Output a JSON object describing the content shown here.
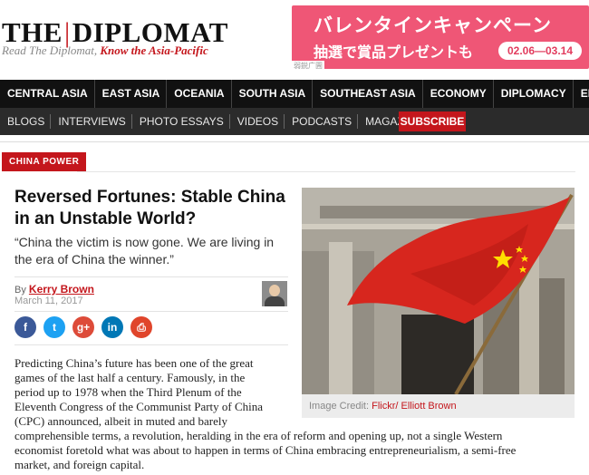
{
  "header": {
    "logo_left": "THE",
    "logo_sep": "|",
    "logo_right": "DIPLOMAT",
    "tagline_plain": "Read The Diplomat,",
    "tagline_em": "Know the Asia-Pacific"
  },
  "ad": {
    "line1": "バレンタインキャンペーン",
    "line2": "抽選で賞品プレゼントも",
    "dates": "02.06—03.14",
    "label": "弱鋭广圊"
  },
  "nav_main": [
    "CENTRAL ASIA",
    "EAST ASIA",
    "OCEANIA",
    "SOUTH ASIA",
    "SOUTHEAST ASIA",
    "ECONOMY",
    "DIPLOMACY",
    "ENVIRON"
  ],
  "nav_secondary": [
    "BLOGS",
    "INTERVIEWS",
    "PHOTO ESSAYS",
    "VIDEOS",
    "PODCASTS",
    "MAGAZINE"
  ],
  "subscribe_label": "SUBSCRIBE",
  "article": {
    "section": "CHINA POWER",
    "title": "Reversed Fortunes: Stable China in an Unstable World?",
    "dek": "“China the victim is now gone. We are living in the era of China the winner.”",
    "by_prefix": "By",
    "author": "Kerry Brown",
    "date": "March 11, 2017",
    "share_icons": [
      {
        "name": "facebook-icon",
        "glyph": "f",
        "color": "#3b5998"
      },
      {
        "name": "twitter-icon",
        "glyph": "t",
        "color": "#1da1f2"
      },
      {
        "name": "google-plus-icon",
        "glyph": "g+",
        "color": "#dd4b39"
      },
      {
        "name": "linkedin-icon",
        "glyph": "in",
        "color": "#0077b5"
      },
      {
        "name": "print-icon",
        "glyph": "⎙",
        "color": "#e0452b"
      }
    ],
    "body_lines": [
      "Predicting China’s future has been one of the great",
      "games of the last half a century. Famously, in the",
      "period up to 1978 when the Third Plenum of the",
      "Eleventh Congress of the Communist Party of China",
      "(CPC) announced, albeit in muted and barely",
      "comprehensible terms, a revolution, heralding in the era of reform and opening up, not a single Western",
      "economist foretold what was about to happen in terms of China embracing entrepreneurialism, a semi-free",
      "market, and foreign capital."
    ]
  },
  "photo": {
    "credit_label": "Image Credit:",
    "credit_link": "Flickr/ Elliott Brown"
  },
  "colors": {
    "brand_red": "#c4161c",
    "nav_dark": "#111111",
    "ad_pink": "#ef5676"
  }
}
